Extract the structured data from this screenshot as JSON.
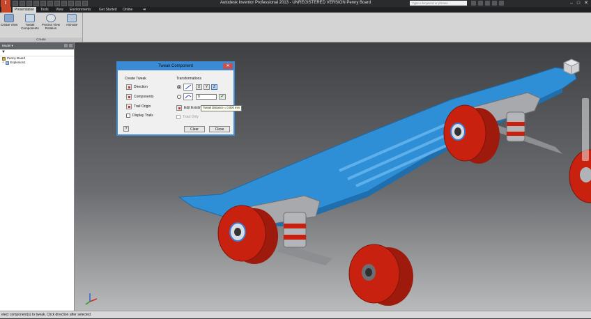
{
  "titlebar": {
    "title": "Autodesk Inventor Professional 2013 - UNREGISTERED VERSION    Penny Board",
    "search_placeholder": "Type a keyword or phrase",
    "window_buttons": [
      "–",
      "□",
      "✕"
    ]
  },
  "tabs": [
    "Presentation",
    "Tools",
    "View",
    "Environments",
    "Get Started",
    "Online"
  ],
  "ribbon": {
    "buttons": [
      "Create View",
      "Tweak Components",
      "Precise View Rotation",
      "Animate"
    ],
    "group_label": "Create"
  },
  "browser": {
    "header": "Model ▾",
    "filter": "▼",
    "tree": [
      "Penny Board",
      "Explosion1"
    ]
  },
  "dialog": {
    "title": "Tweak Component",
    "close": "✕",
    "create_tweak_label": "Create Tweak",
    "direction_label": "Direction",
    "components_label": "Components",
    "trail_origin_label": "Trail Origin",
    "display_trails_label": "Display Trails",
    "transformations_label": "Transformations",
    "axes": [
      "X",
      "Y",
      "Z"
    ],
    "distance_value": "0",
    "apply_icon": "✔",
    "edit_existing_label": "Edit Existing",
    "triad_only_label": "Triad Only",
    "tooltip": "Tweak Distance = 0.000 mm",
    "clear_label": "Clear",
    "close_label": "Close",
    "help_label": "?"
  },
  "statusbar": {
    "text": "elect component(s) to tweak. Click direction after selected."
  },
  "colors": {
    "board": "#2f8fd6",
    "wheel": "#c8210f",
    "dialog_border": "#3a8ad6"
  }
}
